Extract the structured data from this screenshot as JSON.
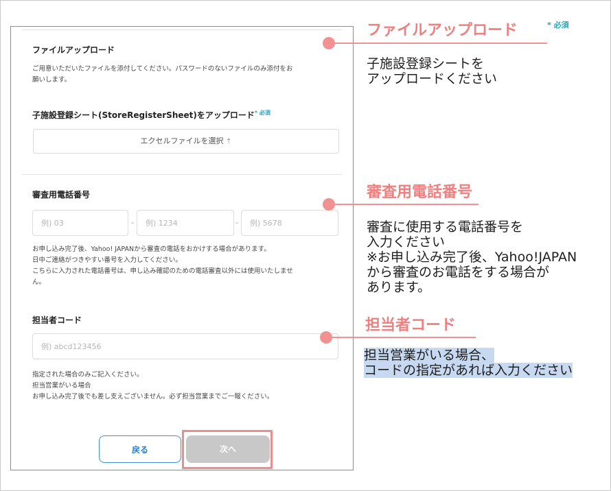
{
  "form": {
    "upload": {
      "title": "ファイルアップロード",
      "desc": [
        "ご用意いただいたファイルを添付してください。パスワードのないファイルのみ添付をお",
        "願いします。"
      ],
      "field_label": "子施設登録シート(StoreRegisterSheet)をアップロード",
      "required": "* 必須",
      "button_label": "エクセルファイルを選択",
      "button_icon": "upload-icon"
    },
    "phone": {
      "title": "審査用電話番号",
      "placeholders": [
        "例) 03",
        "例) 1234",
        "例) 5678"
      ],
      "separator": "-",
      "notes": [
        "お申し込み完了後、Yahoo! JAPANから審査の電話をおかけする場合があります。",
        "日中ご連絡がつきやすい番号を入力してください。",
        "こちらに入力された電話番号は、申し込み確認のための電話審査以外には使用いたしませ",
        "ん。"
      ]
    },
    "rep": {
      "title": "担当者コード",
      "placeholder": "例) abcd123456",
      "notes": [
        "指定された場合のみご記入ください。",
        "担当営業がいる場合",
        "お申し込み完了後でも差し支えございません。必ず担当営業までご一報ください。"
      ]
    },
    "buttons": {
      "back": "戻る",
      "next": "次へ"
    }
  },
  "annotations": {
    "upload": {
      "title": "ファイルアップロード",
      "required": "* 必須",
      "text": [
        "子施設登録シートを",
        "アップロードください"
      ]
    },
    "phone": {
      "title": "審査用電話番号",
      "text": [
        "審査に使用する電話番号を",
        "入力ください",
        "※お申し込み完了後、Yahoo!JAPAN",
        "から審査のお電話をする場合が",
        "あります。"
      ]
    },
    "rep": {
      "title": "担当者コード",
      "text": [
        "担当営業がいる場合、",
        "コードの指定があれば入力ください"
      ]
    }
  },
  "colors": {
    "accent_pink": "#f07f7f",
    "required_teal": "#2aa3b8",
    "back_blue": "#3a8fd8",
    "disabled_gray": "#c8c8c8",
    "highlight_blue": "#c6d9f1"
  }
}
